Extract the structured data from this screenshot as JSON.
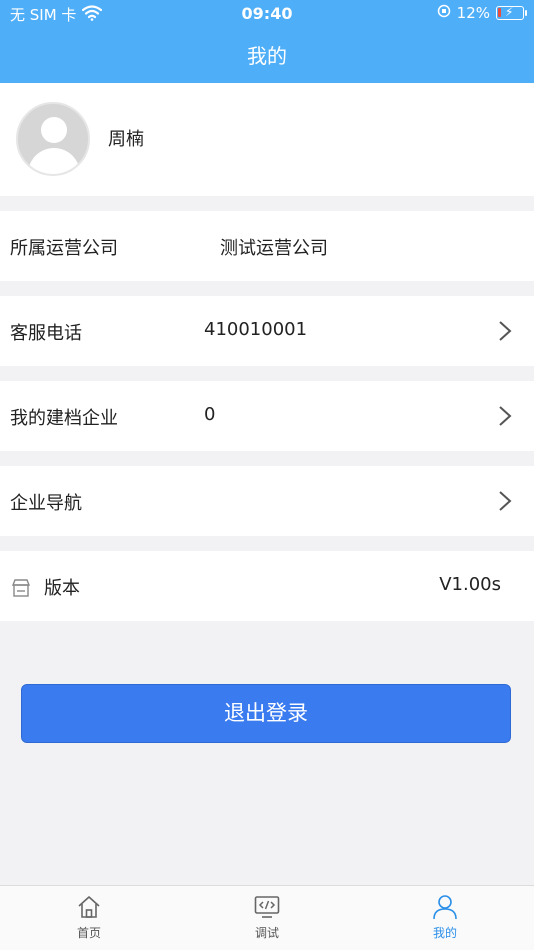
{
  "status_bar": {
    "carrier": "无 SIM 卡",
    "time": "09:40",
    "battery": "12%",
    "battery_level": 0.12
  },
  "nav": {
    "title": "我的"
  },
  "profile": {
    "name": "周楠"
  },
  "rows": {
    "company": {
      "label": "所属运营公司",
      "value": "测试运营公司"
    },
    "service": {
      "label": "客服电话",
      "value": "410010001"
    },
    "enterprises": {
      "label": "我的建档企业",
      "value": "0"
    },
    "navigation": {
      "label": "企业导航",
      "value": ""
    },
    "version": {
      "label": "版本",
      "value": "V1.00s"
    }
  },
  "logout": {
    "label": "退出登录"
  },
  "tabbar": {
    "home": "首页",
    "debug": "调试",
    "mine": "我的"
  },
  "colors": {
    "header": "#4faef8",
    "button": "#3a7bf0",
    "active_tab": "#2b8fe8"
  }
}
